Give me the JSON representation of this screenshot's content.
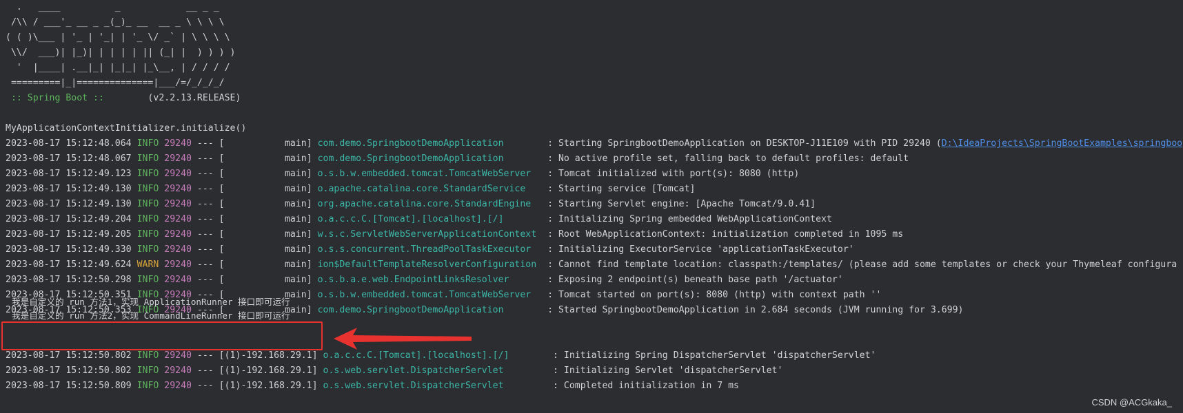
{
  "banner": {
    "lines": [
      "  .   ____          _            __ _ _",
      " /\\\\ / ___'_ __ _ _(_)_ __  __ _ \\ \\ \\ \\",
      "( ( )\\___ | '_ | '_| | '_ \\/ _` | \\ \\ \\ \\",
      " \\\\/  ___)| |_)| | | | | || (_| |  ) ) ) )",
      "  '  |____| .__|_| |_|_| |_\\__, | / / / /",
      " =========|_|==============|___/=/_/_/_/"
    ],
    "spring_label": " :: Spring Boot :: ",
    "version": "       (v2.2.13.RELEASE)"
  },
  "initializer_line": "MyApplicationContextInitializer.initialize()",
  "colors": {
    "background": "#2b2d30",
    "text": "#cfd2d6",
    "info": "#5fb35f",
    "warn": "#d6a23a",
    "pid": "#c77dbb",
    "logger": "#3cb7a8",
    "link": "#4f8fe8",
    "highlight": "#e8322f"
  },
  "log_lines_1": [
    {
      "ts": "2023-08-17 15:12:48.064",
      "level": " INFO",
      "pid": "29240",
      "thread": " --- [           main] ",
      "logger": "com.demo.SpringbootDemoApplication       ",
      "msg": " : Starting SpringbootDemoApplication on DESKTOP-J11E109 with PID 29240 (",
      "link": "D:\\IdeaProjects\\SpringBootExamples\\springboo"
    },
    {
      "ts": "2023-08-17 15:12:48.067",
      "level": " INFO",
      "pid": "29240",
      "thread": " --- [           main] ",
      "logger": "com.demo.SpringbootDemoApplication       ",
      "msg": " : No active profile set, falling back to default profiles: default"
    },
    {
      "ts": "2023-08-17 15:12:49.123",
      "level": " INFO",
      "pid": "29240",
      "thread": " --- [           main] ",
      "logger": "o.s.b.w.embedded.tomcat.TomcatWebServer  ",
      "msg": " : Tomcat initialized with port(s): 8080 (http)"
    },
    {
      "ts": "2023-08-17 15:12:49.130",
      "level": " INFO",
      "pid": "29240",
      "thread": " --- [           main] ",
      "logger": "o.apache.catalina.core.StandardService   ",
      "msg": " : Starting service [Tomcat]"
    },
    {
      "ts": "2023-08-17 15:12:49.130",
      "level": " INFO",
      "pid": "29240",
      "thread": " --- [           main] ",
      "logger": "org.apache.catalina.core.StandardEngine  ",
      "msg": " : Starting Servlet engine: [Apache Tomcat/9.0.41]"
    },
    {
      "ts": "2023-08-17 15:12:49.204",
      "level": " INFO",
      "pid": "29240",
      "thread": " --- [           main] ",
      "logger": "o.a.c.c.C.[Tomcat].[localhost].[/]       ",
      "msg": " : Initializing Spring embedded WebApplicationContext"
    },
    {
      "ts": "2023-08-17 15:12:49.205",
      "level": " INFO",
      "pid": "29240",
      "thread": " --- [           main] ",
      "logger": "w.s.c.ServletWebServerApplicationContext ",
      "msg": " : Root WebApplicationContext: initialization completed in 1095 ms"
    },
    {
      "ts": "2023-08-17 15:12:49.330",
      "level": " INFO",
      "pid": "29240",
      "thread": " --- [           main] ",
      "logger": "o.s.s.concurrent.ThreadPoolTaskExecutor  ",
      "msg": " : Initializing ExecutorService 'applicationTaskExecutor'"
    },
    {
      "ts": "2023-08-17 15:12:49.624",
      "level": " WARN",
      "pid": "29240",
      "thread": " --- [           main] ",
      "logger": "ion$DefaultTemplateResolverConfiguration ",
      "msg": " : Cannot find template location: classpath:/templates/ (please add some templates or check your Thymeleaf configura"
    },
    {
      "ts": "2023-08-17 15:12:50.298",
      "level": " INFO",
      "pid": "29240",
      "thread": " --- [           main] ",
      "logger": "o.s.b.a.e.web.EndpointLinksResolver      ",
      "msg": " : Exposing 2 endpoint(s) beneath base path '/actuator'"
    },
    {
      "ts": "2023-08-17 15:12:50.351",
      "level": " INFO",
      "pid": "29240",
      "thread": " --- [           main] ",
      "logger": "o.s.b.w.embedded.tomcat.TomcatWebServer  ",
      "msg": " : Tomcat started on port(s): 8080 (http) with context path ''"
    },
    {
      "ts": "2023-08-17 15:12:50.353",
      "level": " INFO",
      "pid": "29240",
      "thread": " --- [           main] ",
      "logger": "com.demo.SpringbootDemoApplication       ",
      "msg": " : Started SpringbootDemoApplication in 2.684 seconds (JVM running for 3.699)"
    }
  ],
  "runner_lines": [
    "我是自定义的 run 方法1，实现 ApplicationRunner 接口即可运行",
    "我是自定义的 run 方法2，实现 CommandLineRunner 接口即可运行"
  ],
  "log_lines_2": [
    {
      "ts": "2023-08-17 15:12:50.802",
      "level": " INFO",
      "pid": "29240",
      "thread": " --- [(1)-192.168.29.1] ",
      "logger": "o.a.c.c.C.[Tomcat].[localhost].[/]       ",
      "msg": " : Initializing Spring DispatcherServlet 'dispatcherServlet'"
    },
    {
      "ts": "2023-08-17 15:12:50.802",
      "level": " INFO",
      "pid": "29240",
      "thread": " --- [(1)-192.168.29.1] ",
      "logger": "o.s.web.servlet.DispatcherServlet        ",
      "msg": " : Initializing Servlet 'dispatcherServlet'"
    },
    {
      "ts": "2023-08-17 15:12:50.809",
      "level": " INFO",
      "pid": "29240",
      "thread": " --- [(1)-192.168.29.1] ",
      "logger": "o.s.web.servlet.DispatcherServlet        ",
      "msg": " : Completed initialization in 7 ms"
    }
  ],
  "watermark": "CSDN @ACGkaka_"
}
